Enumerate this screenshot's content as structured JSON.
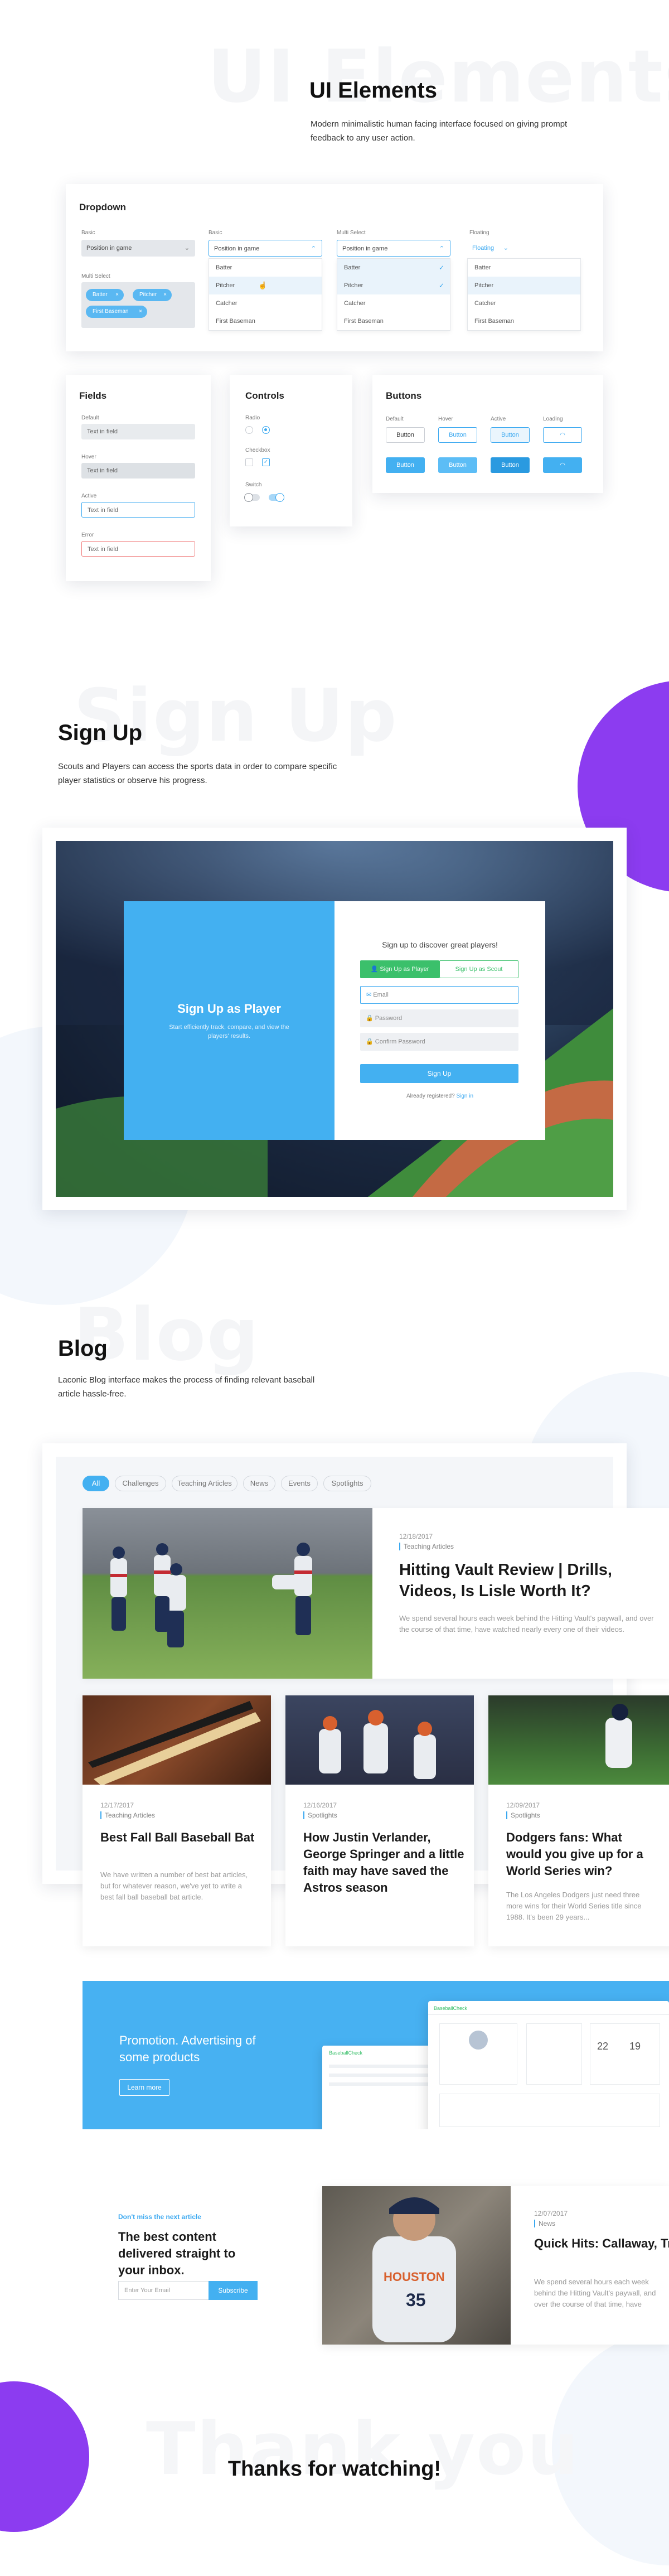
{
  "ui_elements": {
    "ghost": "UI Elements",
    "title": "UI Elements",
    "description": "Modern minimalistic human facing interface focused on giving prompt feedback to any user action.",
    "dropdown": {
      "title": "Dropdown",
      "columns": [
        {
          "label": "Basic",
          "value": "Position in game"
        },
        {
          "label": "Basic",
          "value": "Position in game"
        },
        {
          "label": "Multi Select",
          "value": "Position in game"
        },
        {
          "label": "Floating",
          "value": "Floating"
        }
      ],
      "multi_label": "Multi Select",
      "tags": [
        "Batter",
        "Pitcher",
        "First Baseman"
      ],
      "options": [
        "Batter",
        "Pitcher",
        "Catcher",
        "First Baseman"
      ]
    },
    "fields": {
      "title": "Fields",
      "items": [
        {
          "label": "Default",
          "value": "Text in field"
        },
        {
          "label": "Hover",
          "value": "Text in field"
        },
        {
          "label": "Active",
          "value": "Text in field"
        },
        {
          "label": "Error",
          "value": "Text in field"
        }
      ]
    },
    "controls": {
      "title": "Controls",
      "radio_label": "Radio",
      "checkbox_label": "Checkbox",
      "switch_label": "Switch"
    },
    "buttons": {
      "title": "Buttons",
      "states": [
        "Default",
        "Hover",
        "Active",
        "Loading"
      ],
      "label": "Button"
    }
  },
  "signup": {
    "ghost": "Sign Up",
    "title": "Sign Up",
    "description": "Scouts and Players can access the sports data in order to compare specific player statistics or observe his progress.",
    "left_title": "Sign Up as Player",
    "left_text": "Start efficiently track, compare, and view the players' results.",
    "form_title": "Sign up to discover great players!",
    "tab_player": "Sign Up as Player",
    "tab_scout": "Sign Up as Scout",
    "email_placeholder": "Email",
    "password_placeholder": "Password",
    "confirm_placeholder": "Confirm Password",
    "submit": "Sign Up",
    "already": "Already registered?",
    "signin": "Sign in"
  },
  "blog": {
    "ghost": "Blog",
    "title": "Blog",
    "description": "Laconic Blog interface makes the process of finding relevant baseball article hassle-free.",
    "filters": [
      "All",
      "Challenges",
      "Teaching Articles",
      "News",
      "Events",
      "Spotlights"
    ],
    "featured": {
      "date": "12/18/2017",
      "category": "Teaching Articles",
      "title": "Hitting Vault Review | Drills, Videos, Is Lisle Worth It?",
      "text": "We spend several hours each week behind the Hitting Vault's paywall, and over the course of that time, have watched nearly every one of their videos."
    },
    "posts": [
      {
        "date": "12/17/2017",
        "category": "Teaching Articles",
        "title": "Best Fall Ball Baseball Bat",
        "text": "We have written a number of best bat articles, but for whatever reason, we've yet to write a best fall ball baseball bat article."
      },
      {
        "date": "12/16/2017",
        "category": "Spotlights",
        "title": "How Justin Verlander, George Springer and a little faith may have saved the Astros season",
        "text": ""
      },
      {
        "date": "12/09/2017",
        "category": "Spotlights",
        "title": "Dodgers fans: What would you give up for a World Series win?",
        "text": "The Los Angeles Dodgers just need three more wins for their World Series title since 1988. It's been 29 years..."
      }
    ]
  },
  "promo": {
    "title": "Promotion. Advertising of some products",
    "button": "Learn more",
    "brand": "BaseballCheck",
    "stats": [
      "22",
      "19"
    ]
  },
  "newsletter": {
    "eyebrow": "Don't miss the next article",
    "title": "The best content delivered straight to your inbox.",
    "placeholder": "Enter Your Email",
    "button": "Subscribe"
  },
  "side_post": {
    "date": "12/07/2017",
    "category": "News",
    "title": "Quick Hits: Callaway, Tribe, Santana, Yankees",
    "text": "We spend several hours each week behind the Hitting Vault's paywall, and over the course of that time, have watched nearly"
  },
  "outro": {
    "ghost": "Thank you",
    "text": "Thanks for watching!"
  },
  "colors": {
    "accent": "#43b0f1",
    "green": "#3bc06b",
    "purple": "#8c3cf0"
  }
}
